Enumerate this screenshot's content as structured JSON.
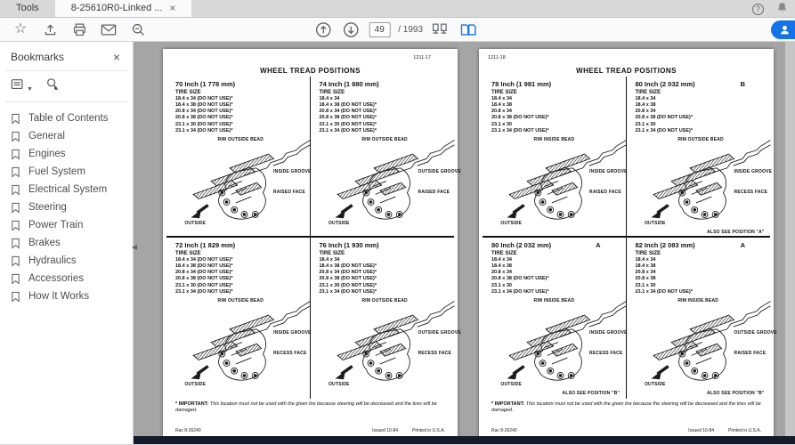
{
  "chrome": {
    "tabs": [
      {
        "label": "Tools"
      },
      {
        "label": "8-25610R0-Linked ...",
        "close": "×"
      }
    ],
    "help": "?",
    "toolbar": {
      "page_current": "49",
      "page_total": "/ 1993"
    }
  },
  "sidebar": {
    "title": "Bookmarks",
    "close": "×",
    "items": [
      "Table of Contents",
      "General",
      "Engines",
      "Fuel System",
      "Electrical System",
      "Steering",
      "Power Train",
      "Brakes",
      "Hydraulics",
      "Accessories",
      "How It Works"
    ]
  },
  "document": {
    "pages": [
      {
        "page_number": "1211-17",
        "title": "WHEEL TREAD POSITIONS",
        "quadrants": [
          {
            "heading": "70 Inch (1 778 mm)",
            "variant": "",
            "tire_size_label": "TIRE SIZE",
            "tires": [
              "18.4 x 34 (DO NOT USE)*",
              "18.4 x 38 (DO NOT USE)*",
              "20.8 x 34 (DO NOT USE)*",
              "20.8 x 38 (DO NOT USE)*",
              "23.1 x 30 (DO NOT USE)*",
              "23.1 x 34 (DO NOT USE)*"
            ],
            "labels": {
              "bead": "RIM OUTSIDE BEAD",
              "groove": "INSIDE GROOVE",
              "face": "RAISED FACE",
              "outside": "OUTSIDE",
              "also": ""
            }
          },
          {
            "heading": "74 Inch (1 880 mm)",
            "variant": "",
            "tire_size_label": "TIRE SIZE",
            "tires": [
              "18.4 x 34",
              "18.4 x 38 (DO NOT USE)*",
              "20.8 x 34 (DO NOT USE)*",
              "20.8 x 38 (DO NOT USE)*",
              "23.1 x 30 (DO NOT USE)*",
              "23.1 x 34 (DO NOT USE)*"
            ],
            "labels": {
              "bead": "RIM OUTSIDE BEAD",
              "groove": "OUTSIDE GROOVE",
              "face": "RAISED FACE",
              "outside": "OUTSIDE",
              "also": ""
            }
          },
          {
            "heading": "72 Inch (1 829 mm)",
            "variant": "",
            "tire_size_label": "TIRE SIZE",
            "tires": [
              "18.4 x 34 (DO NOT USE)*",
              "18.4 x 38 (DO NOT USE)*",
              "20.8 x 34 (DO NOT USE)*",
              "20.8 x 38 (DO NOT USE)*",
              "23.1 x 30 (DO NOT USE)*",
              "23.1 x 34 (DO NOT USE)*"
            ],
            "labels": {
              "bead": "RIM OUTSIDE BEAD",
              "groove": "INSIDE GROOVE",
              "face": "RECESS FACE",
              "outside": "OUTSIDE",
              "also": ""
            }
          },
          {
            "heading": "76 Inch (1 930 mm)",
            "variant": "",
            "tire_size_label": "TIRE SIZE",
            "tires": [
              "18.4 x 34",
              "18.4 x 38 (DO NOT USE)*",
              "20.8 x 34 (DO NOT USE)*",
              "20.8 x 38 (DO NOT USE)*",
              "23.1 x 30 (DO NOT USE)*",
              "23.1 x 34 (DO NOT USE)*"
            ],
            "labels": {
              "bead": "RIM OUTSIDE BEAD",
              "groove": "OUTSIDE GROOVE",
              "face": "RECESS FACE",
              "outside": "OUTSIDE",
              "also": ""
            }
          }
        ],
        "footnote_label": "* IMPORTANT:",
        "footnote_text": "This location must not be used with the given tire because steering will be decreased and the tires will be damaged.",
        "footer_left": "Rac 8-26240",
        "footer_issued": "Issued 10-84",
        "footer_printed": "Printed in U.S.A."
      },
      {
        "page_number": "1211-18",
        "title": "WHEEL TREAD POSITIONS",
        "quadrants": [
          {
            "heading": "78 Inch (1 981 mm)",
            "variant": "",
            "tire_size_label": "TIRE SIZE",
            "tires": [
              "18.4 x 34",
              "18.4 x 38",
              "20.8 x 34",
              "20.8 x 38 (DO NOT USE)*",
              "23.1 x 30",
              "23.1 x 34 (DO NOT USE)*"
            ],
            "labels": {
              "bead": "RIM INSIDE BEAD",
              "groove": "INSIDE GROOVE",
              "face": "RAISED FACE",
              "outside": "OUTSIDE",
              "also": ""
            }
          },
          {
            "heading": "80 Inch (2 032 mm)",
            "variant": "B",
            "tire_size_label": "TIRE SIZE",
            "tires": [
              "18.4 x 34",
              "18.4 x 38",
              "20.8 x 34",
              "20.8 x 38 (DO NOT USE)*",
              "23.1 x 30",
              "23.1 x 34 (DO NOT USE)*"
            ],
            "labels": {
              "bead": "RIM OUTSIDE BEAD",
              "groove": "INSIDE GROOVE",
              "face": "RECESS FACE",
              "outside": "OUTSIDE",
              "also": "ALSO SEE POSITION \"A\""
            }
          },
          {
            "heading": "80 Inch (2 032 mm)",
            "variant": "A",
            "tire_size_label": "TIRE SIZE",
            "tires": [
              "18.4 x 34",
              "18.4 x 38",
              "20.8 x 34",
              "20.8 x 38 (DO NOT USE)*",
              "23.1 x 30",
              "23.1 x 34 (DO NOT USE)*"
            ],
            "labels": {
              "bead": "RIM INSIDE BEAD",
              "groove": "INSIDE GROOVE",
              "face": "RECESS FACE",
              "outside": "OUTSIDE",
              "also": "ALSO SEE POSITION \"B\""
            }
          },
          {
            "heading": "82 Inch (2 083 mm)",
            "variant": "A",
            "tire_size_label": "TIRE SIZE",
            "tires": [
              "18.4 x 34",
              "18.4 x 38",
              "20.8 x 34",
              "20.8 x 38",
              "23.1 x 30",
              "23.1 x 34 (DO NOT USE)*"
            ],
            "labels": {
              "bead": "RIM INSIDE BEAD",
              "groove": "OUTSIDE GROOVE",
              "face": "RAISED FACE",
              "outside": "OUTSIDE",
              "also": "ALSO SEE POSITION \"B\""
            }
          }
        ],
        "footnote_label": "* IMPORTANT:",
        "footnote_text": "This location must not be used with the given tire because the steering will be decreased and the tires will be damaged.",
        "footer_left": "Rac 8-26240",
        "footer_issued": "Issued 10-84",
        "footer_printed": "Printed in U.S.A."
      }
    ]
  }
}
